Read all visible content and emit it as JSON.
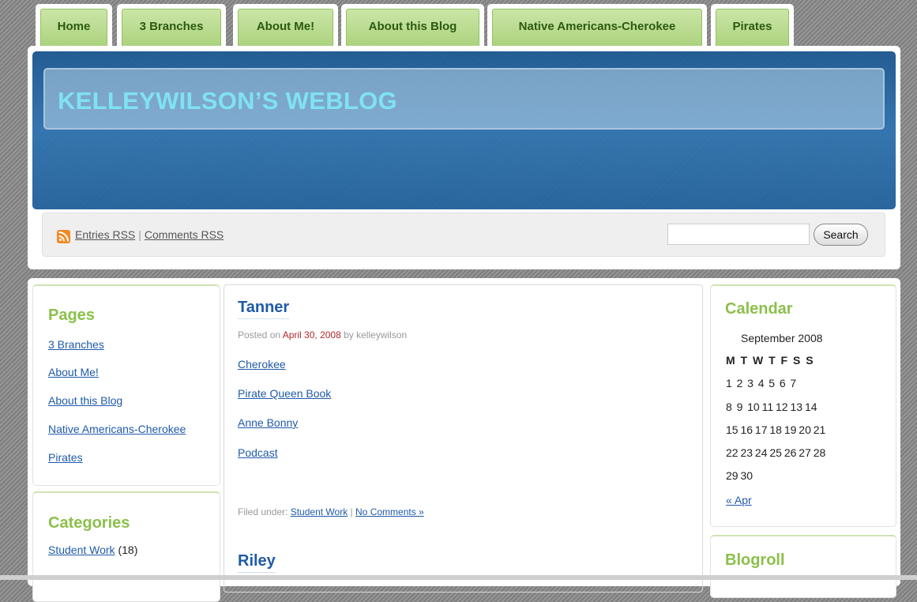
{
  "nav": {
    "tabs": [
      {
        "label": "Home"
      },
      {
        "label": "3 Branches"
      },
      {
        "label": "About Me!"
      },
      {
        "label": "About this Blog"
      },
      {
        "label": "Native Americans-Cherokee"
      },
      {
        "label": "Pirates"
      }
    ]
  },
  "header": {
    "blog_title": "KELLEYWILSON’S WEBLOG",
    "entries_rss": "Entries RSS",
    "separator": "|",
    "comments_rss": "Comments RSS",
    "search_value": "",
    "search_button": "Search",
    "accent_color": "#2c6aa0"
  },
  "pages_widget": {
    "title": "Pages",
    "items": [
      "3 Branches",
      "About Me!",
      "About this Blog",
      "Native Americans-Cherokee",
      "Pirates"
    ]
  },
  "categories_widget": {
    "title": "Categories",
    "items": [
      {
        "label": "Student Work",
        "count": "(18)"
      }
    ]
  },
  "posts": [
    {
      "title": "Tanner",
      "meta_prefix": "Posted on",
      "date": "April 30, 2008",
      "meta_by": "by kelleywilson",
      "links": [
        "Cherokee",
        "Pirate Queen Book",
        "Anne Bonny",
        "Podcast"
      ],
      "filed_prefix": "Filed under:",
      "category": "Student Work",
      "separator": "|",
      "comments": "No Comments »"
    },
    {
      "title": "Riley"
    }
  ],
  "calendar": {
    "title": "Calendar",
    "month": "September 2008",
    "days_header": "M T W T F S S",
    "rows": [
      "1  2  3  4  5  6  7",
      "8  9  10 11 12 13 14",
      "15 16 17 18 19 20 21",
      "22 23 24 25 26 27 28",
      "29 30"
    ],
    "prev_link": "« Apr"
  },
  "blogroll": {
    "title": "Blogroll"
  }
}
